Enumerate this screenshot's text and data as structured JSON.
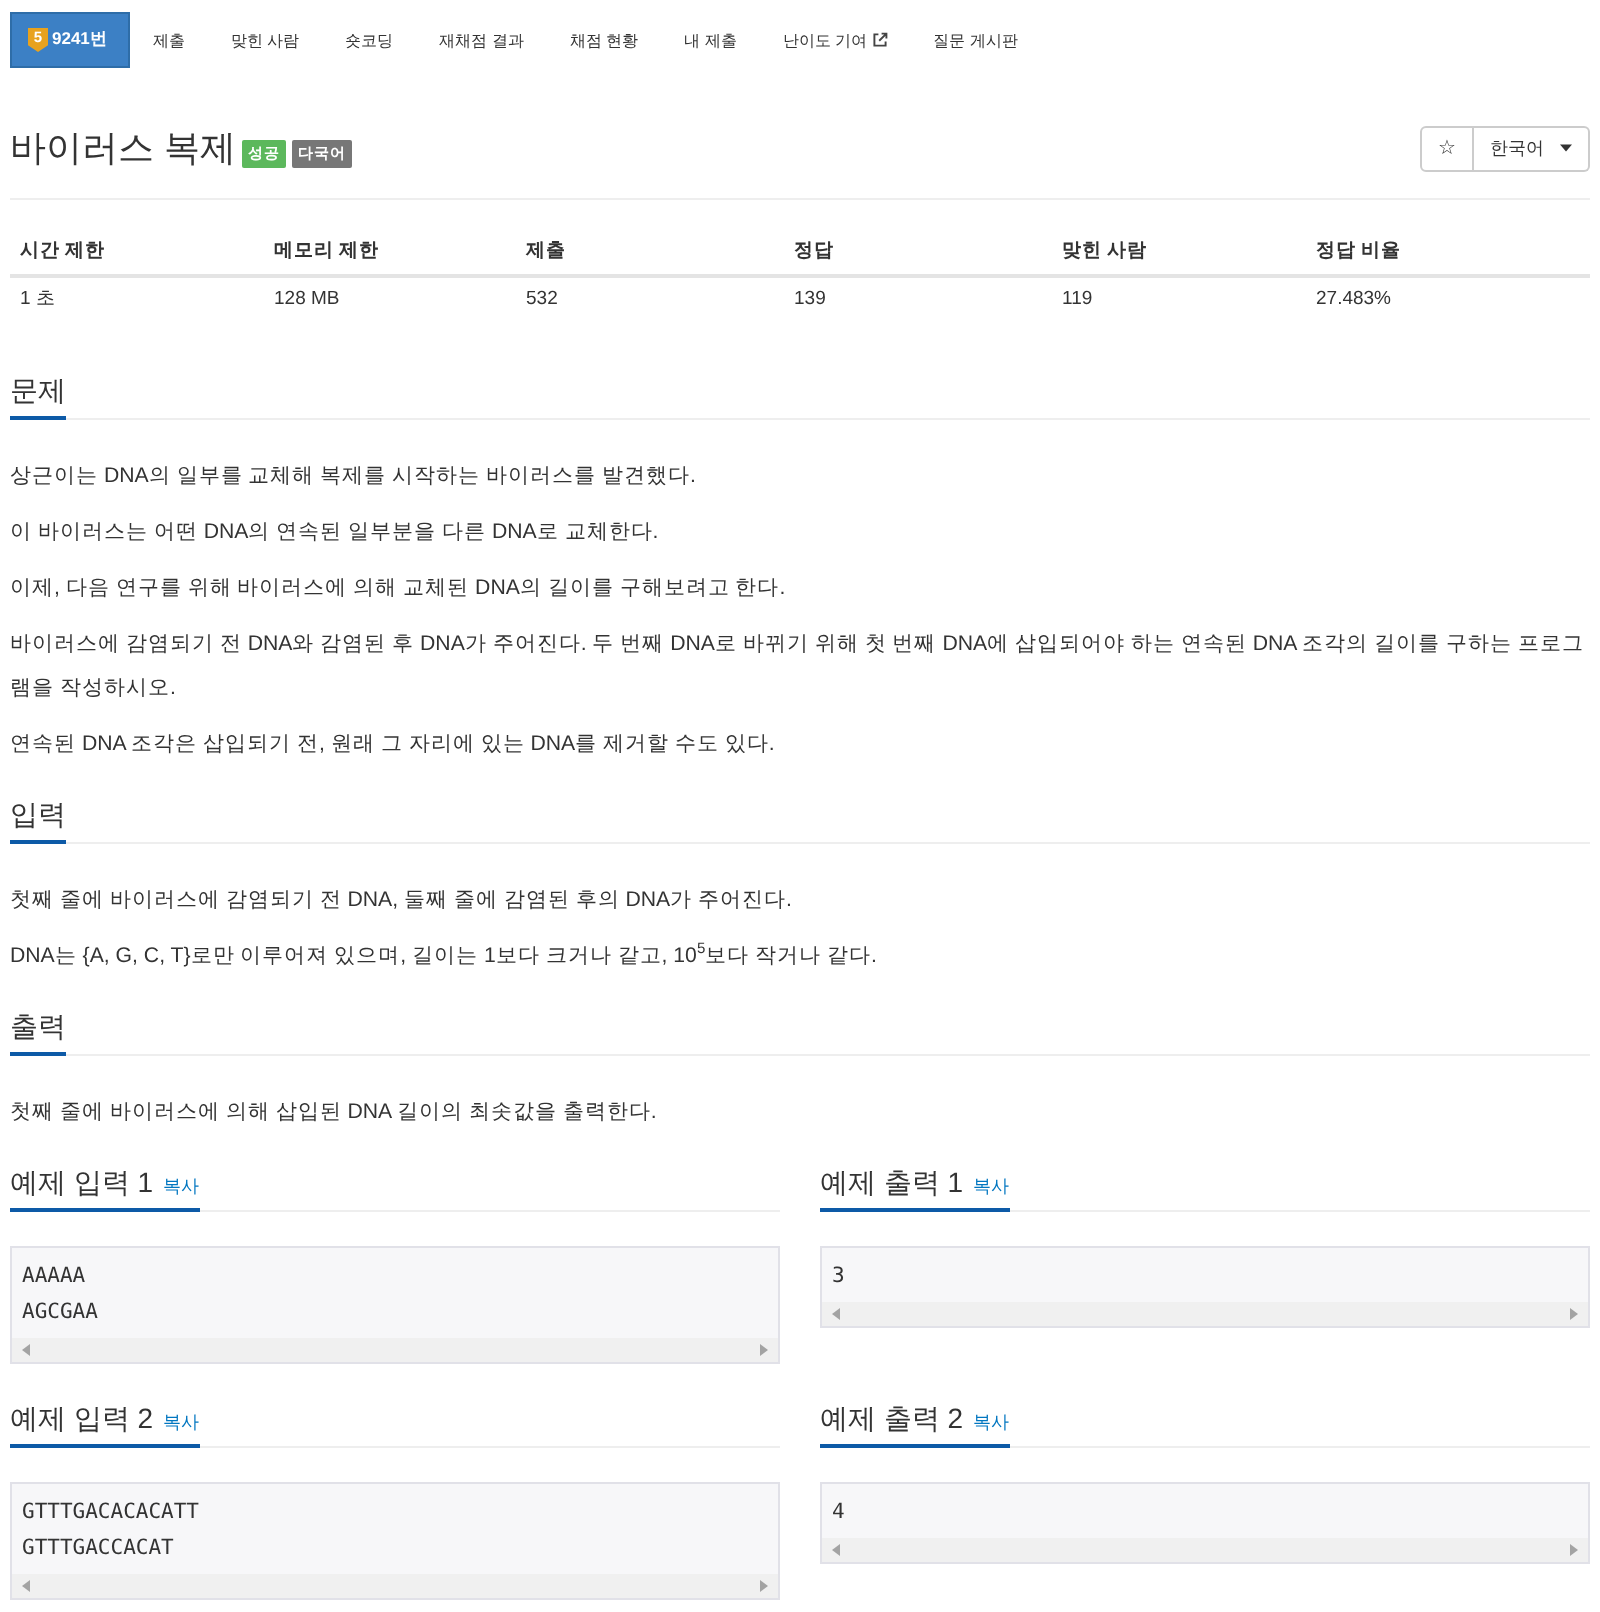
{
  "nav": {
    "tabs": [
      {
        "kind": "problem",
        "tier": "5",
        "label": "9241번",
        "selected": true
      },
      {
        "kind": "plain",
        "label": "제출",
        "selected": false
      },
      {
        "kind": "plain",
        "label": "맞힌 사람",
        "selected": false
      },
      {
        "kind": "plain",
        "label": "숏코딩",
        "selected": false
      },
      {
        "kind": "plain",
        "label": "재채점 결과",
        "selected": false
      },
      {
        "kind": "plain",
        "label": "채점 현황",
        "selected": false
      },
      {
        "kind": "plain",
        "label": "내 제출",
        "selected": false
      },
      {
        "kind": "external",
        "label": "난이도 기여",
        "selected": false
      },
      {
        "kind": "plain",
        "label": "질문 게시판",
        "selected": false
      }
    ]
  },
  "title": {
    "text": "바이러스 복제",
    "badges": [
      {
        "label": "성공",
        "color": "#5cb85c"
      },
      {
        "label": "다국어",
        "color": "#777777"
      }
    ]
  },
  "actions": {
    "star": "☆",
    "language": "한국어"
  },
  "info_table": {
    "columns": [
      "시간 제한",
      "메모리 제한",
      "제출",
      "정답",
      "맞힌 사람",
      "정답 비율"
    ],
    "rows": [
      [
        "1 초",
        "128 MB",
        "532",
        "139",
        "119",
        "27.483%"
      ]
    ]
  },
  "sections": [
    {
      "heading": "문제",
      "paragraphs": [
        "상근이는 DNA의 일부를 교체해 복제를 시작하는 바이러스를 발견했다.",
        "이 바이러스는 어떤 DNA의 연속된 일부분을 다른 DNA로 교체한다.",
        "이제, 다음 연구를 위해 바이러스에 의해 교체된 DNA의 길이를 구해보려고 한다.",
        "바이러스에 감염되기 전 DNA와 감염된 후 DNA가 주어진다. 두 번째 DNA로 바뀌기 위해 첫 번째 DNA에 삽입되어야 하는 연속된 DNA 조각의 길이를 구하는 프로그램을 작성하시오.",
        "연속된 DNA 조각은 삽입되기 전, 원래 그 자리에 있는 DNA를 제거할 수도 있다."
      ]
    },
    {
      "heading": "입력",
      "paragraphs": [
        "첫째 줄에 바이러스에 감염되기 전 DNA, 둘째 줄에 감염된 후의 DNA가 주어진다.",
        "DNA는 {A, G, C, T}로만 이루어져 있으며, 길이는 1보다 크거나 같고, 10$^{5}$보다 작거나 같다."
      ]
    },
    {
      "heading": "출력",
      "paragraphs": [
        "첫째 줄에 바이러스에 의해 삽입된 DNA 길이의 최솟값을 출력한다."
      ]
    }
  ],
  "samples": [
    {
      "heading": "예제 입력 1",
      "copy": "복사",
      "lines": [
        "AAAAA",
        "AGCGAA"
      ]
    },
    {
      "heading": "예제 출력 1",
      "copy": "복사",
      "lines": [
        "3"
      ]
    },
    {
      "heading": "예제 입력 2",
      "copy": "복사",
      "lines": [
        "GTTTGACACACATT",
        "GTTTGACCACAT"
      ]
    },
    {
      "heading": "예제 출력 2",
      "copy": "복사",
      "lines": [
        "4"
      ]
    }
  ]
}
